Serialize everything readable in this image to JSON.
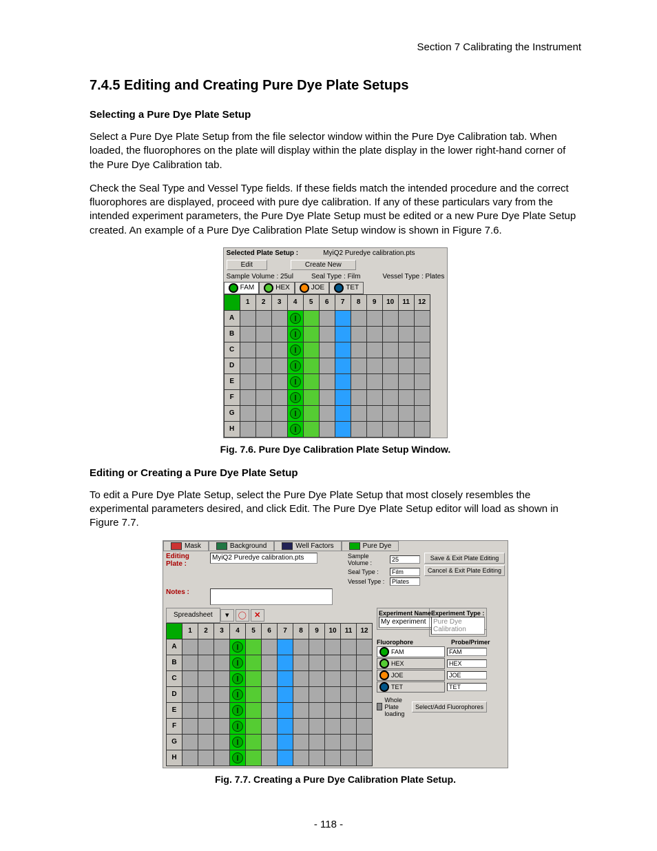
{
  "header": {
    "running": "Section 7 Calibrating the Instrument"
  },
  "title": "7.4.5 Editing and Creating Pure Dye Plate Setups",
  "s1": {
    "h": "Selecting a Pure Dye Plate Setup",
    "p1": "Select a Pure Dye Plate Setup from the file selector window within the Pure Dye Calibration tab. When loaded, the fluorophores on the plate will display within the plate display in the lower right-hand corner of the Pure Dye Calibration tab.",
    "p2": "Check the Seal Type and Vessel Type fields. If these fields match the intended procedure and the correct fluorophores are displayed, proceed with pure dye calibration. If any of these particulars vary from the intended experiment parameters, the Pure Dye Plate Setup must be edited or a new Pure Dye Plate Setup created. An example of a Pure Dye Calibration Plate Setup window is shown in Figure 7.6."
  },
  "fig1": {
    "caption": "Fig. 7.6. Pure Dye Calibration Plate Setup Window.",
    "selected_label": "Selected Plate Setup :",
    "selected_value": "MyiQ2 Puredye calibration.pts",
    "edit_btn": "Edit",
    "create_btn": "Create New",
    "sample_vol": "Sample Volume : 25ul",
    "seal_type": "Seal Type : Film",
    "vessel_type": "Vessel Type : Plates",
    "dyes": [
      "FAM",
      "HEX",
      "JOE",
      "TET"
    ],
    "cols": [
      "1",
      "2",
      "3",
      "4",
      "5",
      "6",
      "7",
      "8",
      "9",
      "10",
      "11",
      "12"
    ],
    "rows": [
      "A",
      "B",
      "C",
      "D",
      "E",
      "F",
      "G",
      "H"
    ]
  },
  "s2": {
    "h": "Editing or Creating a Pure Dye Plate Setup",
    "p1": "To edit a Pure Dye Plate Setup, select the Pure Dye Plate Setup that most closely resembles the experimental parameters desired, and click Edit. The Pure Dye Plate Setup editor will load as shown in Figure 7.7."
  },
  "fig2": {
    "caption": "Fig. 7.7. Creating a Pure Dye Calibration Plate Setup.",
    "tabs": [
      "Mask",
      "Background",
      "Well Factors",
      "Pure Dye"
    ],
    "editing_label": "Editing Plate :",
    "editing_value": "MyiQ2 Puredye calibration.pts",
    "notes_label": "Notes :",
    "sv_label": "Sample Volume :",
    "sv_value": "25",
    "seal_label": "Seal Type :",
    "seal_value": "Film",
    "vt_label": "Vessel Type :",
    "vt_value": "Plates",
    "save_btn": "Save & Exit Plate Editing",
    "cancel_btn": "Cancel & Exit Plate Editing",
    "spreadsheet_tab": "Spreadsheet",
    "exp_name_label": "Experiment Name :",
    "exp_name_value": "My experiment",
    "exp_type_label": "Experiment Type :",
    "exp_type_value": "Pure Dye Calibration",
    "fl_header": "Fluorophore",
    "pp_header": "Probe/Primer",
    "fluors": [
      {
        "name": "FAM",
        "pp": "FAM",
        "cls": "fam",
        "sel": true
      },
      {
        "name": "HEX",
        "pp": "HEX",
        "cls": "hex"
      },
      {
        "name": "JOE",
        "pp": "JOE",
        "cls": "joe"
      },
      {
        "name": "TET",
        "pp": "TET",
        "cls": "tet"
      }
    ],
    "whole_plate": "Whole Plate loading",
    "select_add": "Select/Add Fluorophores",
    "cols": [
      "1",
      "2",
      "3",
      "4",
      "5",
      "6",
      "7",
      "8",
      "9",
      "10",
      "11",
      "12"
    ],
    "rows": [
      "A",
      "B",
      "C",
      "D",
      "E",
      "F",
      "G",
      "H"
    ]
  },
  "page_number": "- 118 -"
}
